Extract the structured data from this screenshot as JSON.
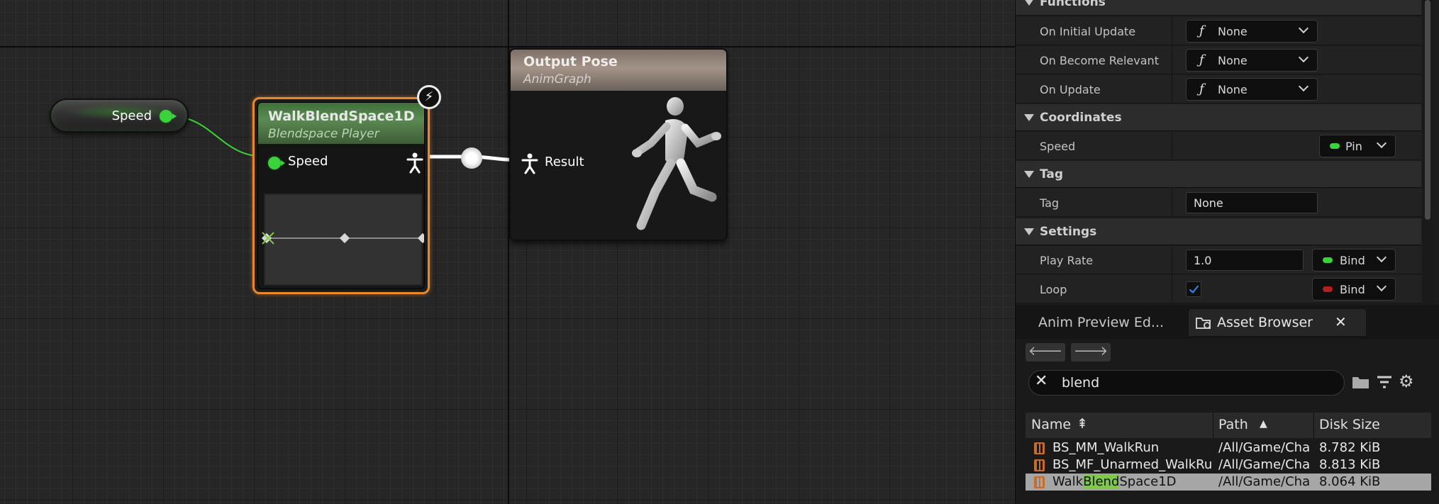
{
  "graph": {
    "speed_node": {
      "label": "Speed"
    },
    "blendspace_node": {
      "title": "WalkBlendSpace1D",
      "subtitle": "Blendspace Player",
      "input_label": "Speed"
    },
    "output_node": {
      "title": "Output Pose",
      "subtitle": "AnimGraph",
      "result_label": "Result"
    }
  },
  "details": {
    "sections": {
      "functions": "Functions",
      "coordinates": "Coordinates",
      "tag": "Tag",
      "settings": "Settings"
    },
    "on_initial_update": {
      "label": "On Initial Update",
      "value": "None"
    },
    "on_become_relevant": {
      "label": "On Become Relevant",
      "value": "None"
    },
    "on_update": {
      "label": "On Update",
      "value": "None"
    },
    "speed": {
      "label": "Speed",
      "pin": "Pin"
    },
    "tag_field": {
      "label": "Tag",
      "value": "None"
    },
    "play_rate": {
      "label": "Play Rate",
      "value": "1.0",
      "bind": "Bind"
    },
    "loop": {
      "label": "Loop",
      "bind": "Bind"
    }
  },
  "assets": {
    "tabs": {
      "anim_preview": "Anim Preview Ed...",
      "asset_browser": "Asset Browser"
    },
    "search": {
      "value": "blend"
    },
    "columns": {
      "name": "Name",
      "path": "Path",
      "disk_size": "Disk Size"
    },
    "rows": [
      {
        "name": "BS_MM_WalkRun",
        "path": "/All/Game/Cha",
        "size": "8.782 KiB"
      },
      {
        "name": "BS_MF_Unarmed_WalkRu",
        "path": "/All/Game/Cha",
        "size": "8.813 KiB"
      },
      {
        "name_pre": "Walk",
        "name_hl": "Blend",
        "name_post": "Space1D",
        "path": "/All/Game/Cha",
        "size": "8.064 KiB"
      }
    ]
  },
  "colors": {
    "selection_orange": "#e8882a",
    "float_pin_green": "#3bd33b",
    "bool_pin_red": "#b42020",
    "checkbox_blue": "#2d8cf0",
    "search_highlight": "#7ec84a"
  }
}
